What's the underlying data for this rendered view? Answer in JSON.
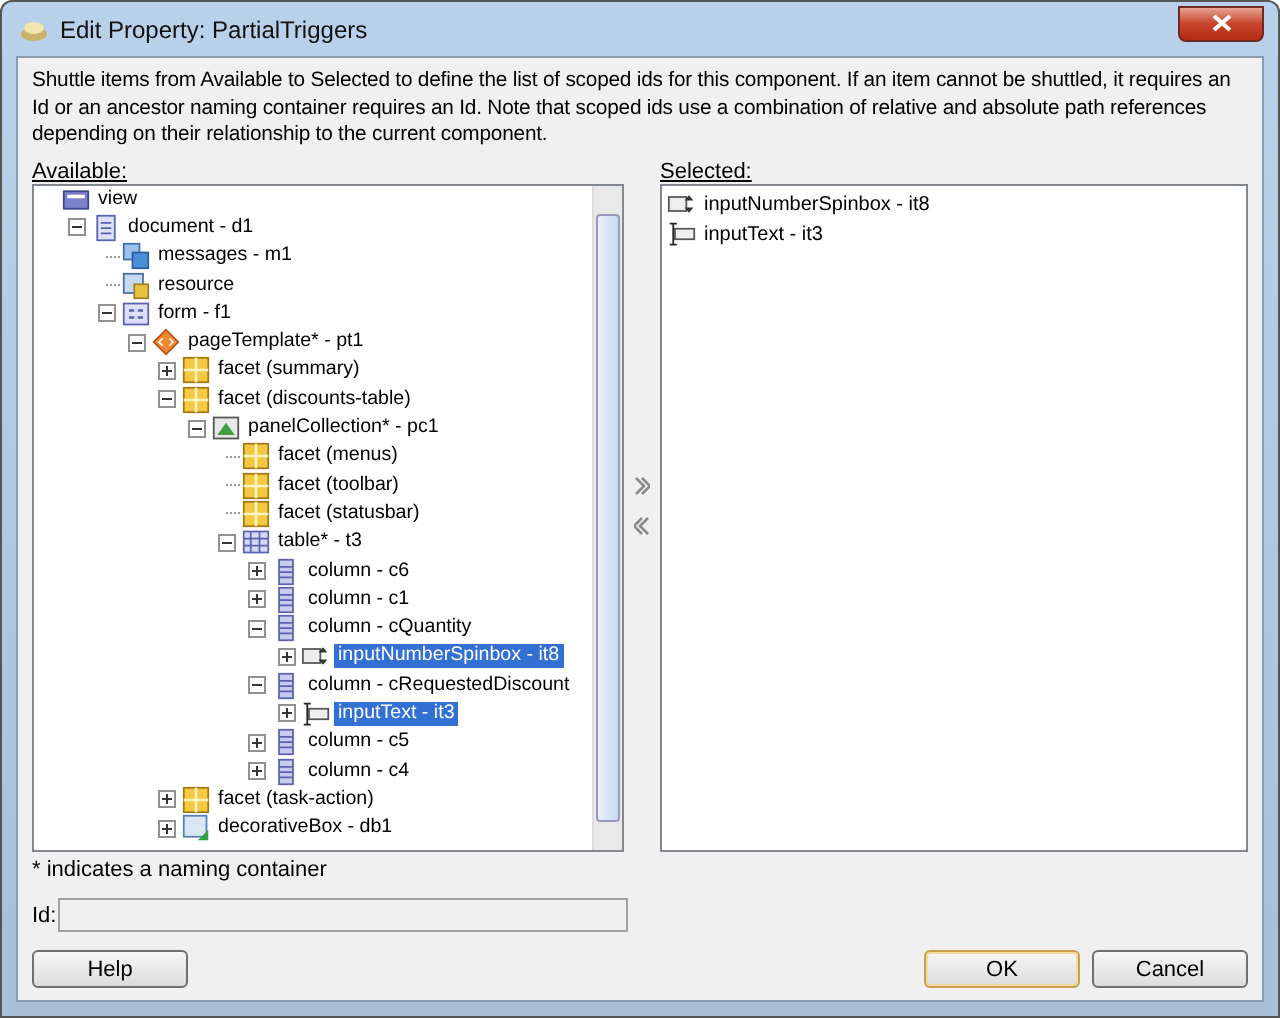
{
  "window": {
    "title": "Edit Property: PartialTriggers"
  },
  "description": "Shuttle items from Available to Selected to define the list of scoped ids for this component. If an item cannot be shuttled, it requires an Id or an ancestor naming container requires an Id. Note that scoped ids use a combination of relative and absolute path references depending on their relationship to the current component.",
  "available": {
    "label": "Available:",
    "tree": [
      {
        "label": "view",
        "kind": "view",
        "selected": false,
        "children": [
          {
            "label": "document - d1",
            "kind": "document",
            "expanded": true,
            "selected": false,
            "children": [
              {
                "label": "messages - m1",
                "kind": "messages",
                "selected": false
              },
              {
                "label": "resource",
                "kind": "resource",
                "selected": false
              },
              {
                "label": "form - f1",
                "kind": "form",
                "expanded": true,
                "selected": false,
                "children": [
                  {
                    "label": "pageTemplate* - pt1",
                    "kind": "template",
                    "expanded": true,
                    "selected": false,
                    "children": [
                      {
                        "label": "facet (summary)",
                        "kind": "facet",
                        "expanded": false,
                        "selected": false
                      },
                      {
                        "label": "facet (discounts-table)",
                        "kind": "facet",
                        "expanded": true,
                        "selected": false,
                        "children": [
                          {
                            "label": "panelCollection* - pc1",
                            "kind": "panel",
                            "expanded": true,
                            "selected": false,
                            "children": [
                              {
                                "label": "facet (menus)",
                                "kind": "facet",
                                "selected": false
                              },
                              {
                                "label": "facet (toolbar)",
                                "kind": "facet",
                                "selected": false
                              },
                              {
                                "label": "facet (statusbar)",
                                "kind": "facet",
                                "selected": false
                              },
                              {
                                "label": "table* - t3",
                                "kind": "table",
                                "expanded": true,
                                "selected": false,
                                "children": [
                                  {
                                    "label": "column - c6",
                                    "kind": "column",
                                    "expanded": false,
                                    "selected": false
                                  },
                                  {
                                    "label": "column - c1",
                                    "kind": "column",
                                    "expanded": false,
                                    "selected": false
                                  },
                                  {
                                    "label": "column - cQuantity",
                                    "kind": "column",
                                    "expanded": true,
                                    "selected": false,
                                    "children": [
                                      {
                                        "label": "inputNumberSpinbox - it8",
                                        "kind": "spinbox",
                                        "expanded": false,
                                        "selected": true
                                      }
                                    ]
                                  },
                                  {
                                    "label": "column - cRequestedDiscount",
                                    "kind": "column",
                                    "expanded": true,
                                    "selected": false,
                                    "children": [
                                      {
                                        "label": "inputText - it3",
                                        "kind": "inputtext",
                                        "expanded": false,
                                        "selected": true
                                      }
                                    ]
                                  },
                                  {
                                    "label": "column - c5",
                                    "kind": "column",
                                    "expanded": false,
                                    "selected": false
                                  },
                                  {
                                    "label": "column - c4",
                                    "kind": "column",
                                    "expanded": false,
                                    "selected": false
                                  }
                                ]
                              }
                            ]
                          }
                        ]
                      },
                      {
                        "label": "facet (task-action)",
                        "kind": "facet",
                        "expanded": false,
                        "selected": false
                      },
                      {
                        "label": "decorativeBox - db1",
                        "kind": "box",
                        "expanded": false,
                        "selected": false
                      }
                    ]
                  }
                ]
              }
            ]
          }
        ]
      }
    ]
  },
  "selected": {
    "label": "Selected:",
    "items": [
      {
        "label": "inputNumberSpinbox - it8",
        "kind": "spinbox"
      },
      {
        "label": "inputText - it3",
        "kind": "inputtext"
      }
    ]
  },
  "footnote": "* indicates a naming container",
  "id_field": {
    "label": "Id:"
  },
  "buttons": [
    {
      "label": "Help",
      "kind": "help"
    },
    {
      "label": "OK",
      "kind": "default"
    },
    {
      "label": "Cancel",
      "kind": "normal"
    }
  ]
}
